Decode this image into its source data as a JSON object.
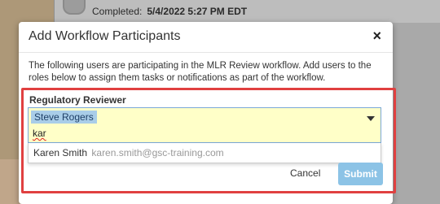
{
  "background": {
    "completed_label": "Completed:",
    "completed_value": "5/4/2022 5:27 PM EDT"
  },
  "dialog": {
    "title": "Add Workflow Participants",
    "close_glyph": "×",
    "description": "The following users are participating in the MLR Review workflow.  Add users to the roles below to assign them tasks or notifications as part of the workflow.",
    "role": {
      "label": "Regulatory Reviewer",
      "selected_token": "Steve Rogers",
      "search_value": "kar",
      "suggestion": {
        "match": "Kar",
        "rest": "en Smith",
        "email": "karen.smith@gsc-training.com"
      }
    },
    "buttons": {
      "cancel": "Cancel",
      "submit": "Submit"
    }
  },
  "colors": {
    "highlight_border": "#e04040",
    "select_background": "#ffffc8",
    "token_background": "#a9cde8",
    "submit_background": "#8cc3e6"
  }
}
